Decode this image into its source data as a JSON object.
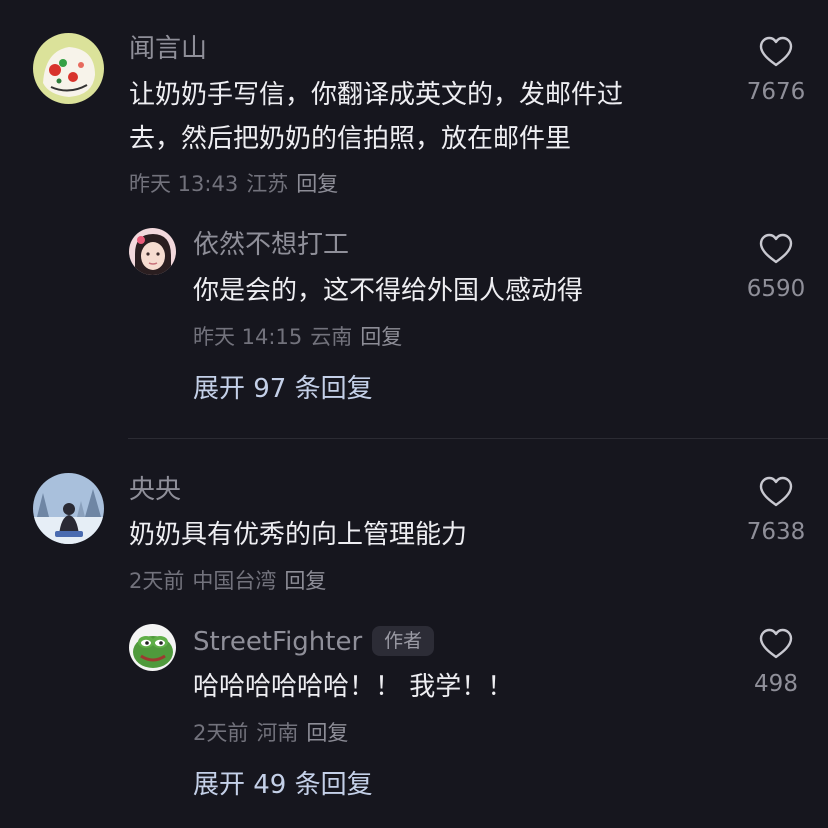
{
  "comments": [
    {
      "username": "闻言山",
      "text_line1": "让奶奶手写信，你翻译成英文的，发邮件过",
      "text_line2": "去，然后把奶奶的信拍照，放在邮件里",
      "time": "昨天 13:43",
      "location": "江苏",
      "reply_label": "回复",
      "likes": "7676",
      "avatar_icon": "cartoon-face-avatar",
      "reply": {
        "username": "依然不想打工",
        "text": "你是会的，这不得给外国人感动得",
        "time": "昨天 14:15",
        "location": "云南",
        "reply_label": "回复",
        "likes": "6590",
        "avatar_icon": "girl-portrait-avatar"
      },
      "expand_label": "展开 97 条回复"
    },
    {
      "username": "央央",
      "text": "奶奶具有优秀的向上管理能力",
      "time": "2天前",
      "location": "中国台湾",
      "reply_label": "回复",
      "likes": "7638",
      "avatar_icon": "snow-scene-avatar",
      "reply": {
        "username": "StreetFighter",
        "badge": "作者",
        "text": "哈哈哈哈哈哈！！ 我学！！",
        "time": "2天前",
        "location": "河南",
        "reply_label": "回复",
        "likes": "498",
        "avatar_icon": "pepe-frog-avatar"
      },
      "expand_label": "展开 49 条回复"
    }
  ],
  "colors": {
    "background": "#16161e",
    "primary_text": "#eeeef2",
    "secondary_text": "#8f8f99",
    "expand_link": "#c4d0e8"
  }
}
